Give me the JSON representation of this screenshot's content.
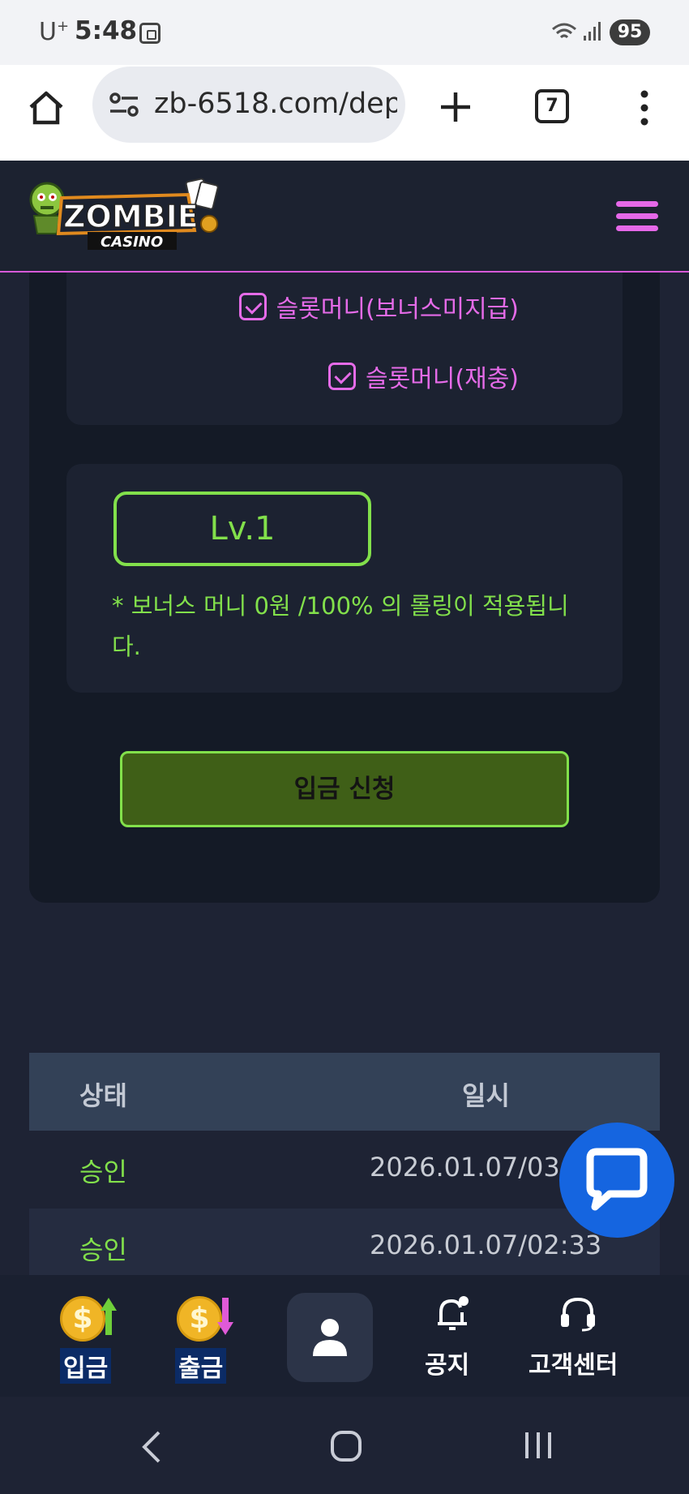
{
  "status_bar": {
    "carrier": "U",
    "carrier_sup": "+",
    "time": "5:48",
    "battery": "95"
  },
  "browser": {
    "url": "zb-6518.com/dep",
    "tab_count": "7"
  },
  "header": {
    "logo_icon": "zombie-casino-logo",
    "menu_icon": "hamburger-icon",
    "accent": "#e568e8"
  },
  "options": [
    {
      "label": "슬롯머니(보너스미지급)",
      "checked": true
    },
    {
      "label": "슬롯머니(재충)",
      "checked": true
    }
  ],
  "level": {
    "label": "Lv.1",
    "note": "* 보너스 머니 0원 /100% 의 롤링이 적용됩니다."
  },
  "submit_label": "입금 신청",
  "table": {
    "headers": [
      "상태",
      "일시"
    ],
    "rows": [
      {
        "status": "승인",
        "date": "2026.01.07/03"
      },
      {
        "status": "승인",
        "date": "2026.01.07/02:33"
      }
    ]
  },
  "bottom_nav": [
    {
      "label": "입금",
      "icon": "coin-up-icon"
    },
    {
      "label": "출금",
      "icon": "coin-down-icon"
    },
    {
      "label": "",
      "icon": "user-icon"
    },
    {
      "label": "공지",
      "icon": "bell-icon"
    },
    {
      "label": "고객센터",
      "icon": "headset-icon"
    }
  ],
  "colors": {
    "green": "#82e04b",
    "pink": "#e568e8",
    "chat_blue": "#1565e0"
  }
}
